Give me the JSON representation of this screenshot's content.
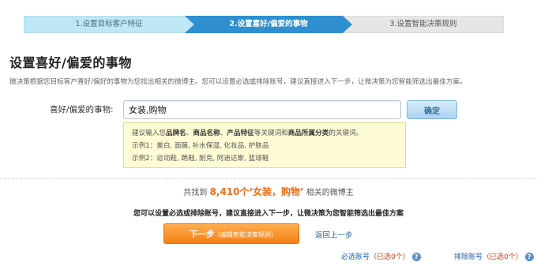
{
  "steps": [
    {
      "label": "1.设置目标客户特征"
    },
    {
      "label": "2.设置喜好/偏爱的事物"
    },
    {
      "label": "3.设置智能决策规则"
    }
  ],
  "page": {
    "title": "设置喜好/偏爱的事物",
    "description": "微决策根据您目标客户喜好/偏好的事物为您找出相关的微博主。您可以设置必选或排除账号，建议直接进入下一步，让微决策为您智能筛选出最佳方案。"
  },
  "form": {
    "label": "喜好/偏爱的事物:",
    "value": "女装,购物",
    "confirm_label": "确定"
  },
  "hint": {
    "prefix": "建议输入您",
    "kw1": "品牌名",
    "sep1": "、",
    "kw2": "商品名称",
    "sep2": "、",
    "kw3": "产品特征",
    "mid": "等关键词和",
    "kw4": "商品所属分类",
    "suffix": "的关键词。",
    "example1": "示例1：美白, 面膜, 补水保湿, 化妆品, 护肤品",
    "example2": "示例2：运动鞋, 跑鞋, 耐克, 阿迪达斯, 篮球鞋"
  },
  "result": {
    "prefix": "共找到",
    "highlight": "8,410个‘女装，购物’",
    "suffix": "相关的微博主"
  },
  "notice": "您可以设置必选或排除账号，建议直接进入下一步，让微决策为您智能筛选出最佳方案",
  "actions": {
    "next_label": "下一步",
    "next_sub": "(编辑智能决策规则)",
    "back_label": "返回上一步"
  },
  "counters": {
    "required_label": "必选账号",
    "required_count": "（已选0个）",
    "excluded_label": "排除账号",
    "excluded_count": "（已选0个）"
  },
  "colors": {
    "step_done": "#bfe6f4",
    "step_active": "#2f8fcf",
    "step_pending": "#e6e6e6",
    "accent_orange": "#f57f15",
    "link_blue": "#1f5fa8"
  }
}
